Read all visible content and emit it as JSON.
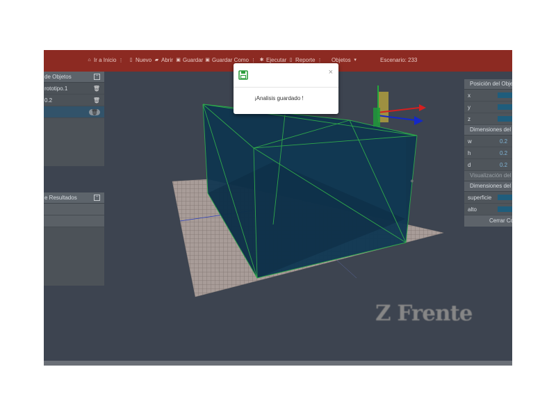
{
  "toolbar": {
    "home_label": "Ir a Inicio",
    "new_label": "Nuevo",
    "open_label": "Abrir",
    "save_label": "Guardar",
    "save_as_label": "Guardar Como",
    "execute_label": "Ejecutar",
    "report_label": "Reporte",
    "objects_label": "Objetos",
    "scenario_label": "Escenario: 233"
  },
  "objects_panel": {
    "title": "de Objetos",
    "items": [
      {
        "label": "rototipo.1"
      },
      {
        "label": "0.2"
      },
      {
        "label": ""
      }
    ]
  },
  "results_panel": {
    "title": "e Resultados"
  },
  "position_panel": {
    "title": "Posición del Objeto",
    "fields": [
      {
        "label": "x"
      },
      {
        "label": "y"
      },
      {
        "label": "z"
      }
    ]
  },
  "dimensions_panel": {
    "title": "Dimensiones del",
    "fields": [
      {
        "label": "w",
        "value": "0.2"
      },
      {
        "label": "h",
        "value": "0.2"
      },
      {
        "label": "d",
        "value": "0.2"
      }
    ]
  },
  "visualization_panel": {
    "title": "Visualización del"
  },
  "dimensions_panel_2": {
    "title": "Dimensiones del",
    "fields": [
      {
        "label": "superficie"
      },
      {
        "label": "alto"
      }
    ],
    "close_label": "Cerrar Co"
  },
  "modal": {
    "message": "¡Analisis guardado !",
    "close_symbol": "×"
  },
  "scene": {
    "brand_text": "Z Frente"
  },
  "colors": {
    "topbar": "#8c2a22",
    "accent_blue": "#1f5d7c",
    "save_icon": "#2e9e3e"
  }
}
